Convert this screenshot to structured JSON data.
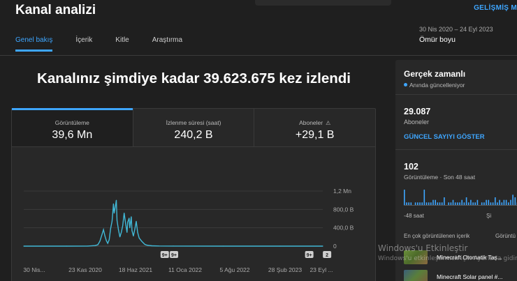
{
  "header": {
    "title": "Kanal analizi",
    "advanced_link": "GELİŞMİŞ M"
  },
  "tabs": [
    {
      "label": "Genel bakış",
      "active": true
    },
    {
      "label": "İçerik",
      "active": false
    },
    {
      "label": "Kitle",
      "active": false
    },
    {
      "label": "Araştırma",
      "active": false
    }
  ],
  "date_range": {
    "range": "30 Nis 2020 – 24 Eyl 2023",
    "label": "Ömür boyu"
  },
  "headline": "Kanalınız şimdiye kadar 39.623.675 kez izlendi",
  "metrics": [
    {
      "label": "Görüntüleme",
      "value": "39,6 Mn",
      "active": true
    },
    {
      "label": "İzlenme süresi (saat)",
      "value": "240,2 B",
      "active": false
    },
    {
      "label": "Aboneler",
      "value": "+29,1 B",
      "active": false,
      "icon": "warning-icon"
    }
  ],
  "chart_data": {
    "type": "line",
    "ylabel": "",
    "xlabel": "",
    "y_tick_labels": [
      "1,2 Mn",
      "800,0 B",
      "400,0 B",
      "0"
    ],
    "y_ticks": [
      1200000,
      800000,
      400000,
      0
    ],
    "ylim": [
      0,
      1200000
    ],
    "x_tick_labels": [
      "30 Nis...",
      "23 Kas 2020",
      "18 Haz 2021",
      "11 Oca 2022",
      "5 Ağu 2022",
      "28 Şub 2023",
      "23 Eyl ..."
    ],
    "grid": true,
    "color": "#41b8d6",
    "series": [
      {
        "values": [
          [
            0,
            0
          ],
          [
            60,
            0
          ],
          [
            90,
            2000
          ],
          [
            100,
            12000
          ],
          [
            104,
            30000
          ],
          [
            107,
            110000
          ],
          [
            110,
            260000
          ],
          [
            112,
            360000
          ],
          [
            114,
            220000
          ],
          [
            116,
            120000
          ],
          [
            118,
            60000
          ],
          [
            120,
            140000
          ],
          [
            122,
            380000
          ],
          [
            124,
            540000
          ],
          [
            126,
            920000
          ],
          [
            127,
            720000
          ],
          [
            129,
            900000
          ],
          [
            130,
            1000000
          ],
          [
            131,
            560000
          ],
          [
            133,
            360000
          ],
          [
            135,
            200000
          ],
          [
            137,
            300000
          ],
          [
            139,
            440000
          ],
          [
            141,
            720000
          ],
          [
            143,
            500000
          ],
          [
            145,
            300000
          ],
          [
            146,
            520000
          ],
          [
            148,
            610000
          ],
          [
            149,
            400000
          ],
          [
            151,
            640000
          ],
          [
            152,
            340000
          ],
          [
            154,
            220000
          ],
          [
            156,
            370000
          ],
          [
            158,
            540000
          ],
          [
            160,
            300000
          ],
          [
            162,
            180000
          ],
          [
            164,
            140000
          ],
          [
            166,
            100000
          ],
          [
            168,
            70000
          ],
          [
            170,
            40000
          ],
          [
            172,
            26000
          ],
          [
            175,
            16000
          ],
          [
            180,
            8000
          ],
          [
            190,
            3000
          ],
          [
            210,
            1500
          ],
          [
            280,
            600
          ],
          [
            360,
            300
          ],
          [
            420,
            200
          ]
        ]
      }
    ],
    "annotations": [
      {
        "label": "9+",
        "x": 198
      },
      {
        "label": "9+",
        "x": 211
      },
      {
        "label": "9+",
        "x": 401
      },
      {
        "label": "2",
        "x": 426
      }
    ]
  },
  "realtime": {
    "title": "Gerçek zamanlı",
    "live_label": "Anında güncelleniyor",
    "subscribers": "29.087",
    "subscribers_label": "Aboneler",
    "show_button": "GÜNCEL SAYIYI GÖSTER",
    "views": "102",
    "views_label": "Görüntüleme · Son 48 saat",
    "bar_axis_left": "-48 saat",
    "bar_axis_right": "Şi",
    "top_content_label": "En çok görüntülenen içerik",
    "top_content_label_2": "Görüntü",
    "bar_values": [
      6,
      1,
      1,
      1,
      0,
      1,
      1,
      1,
      1,
      6,
      1,
      1,
      1,
      2,
      2,
      1,
      1,
      1,
      3,
      0,
      1,
      1,
      2,
      1,
      1,
      1,
      2,
      1,
      3,
      1,
      2,
      1,
      1,
      2,
      0,
      1,
      1,
      2,
      2,
      1,
      1,
      3,
      1,
      2,
      1,
      2,
      2,
      1,
      2,
      4,
      3,
      1,
      5
    ],
    "items": [
      {
        "title": "Minecraft Otomatik Taş..."
      },
      {
        "title": "Minecraft Solar panel #..."
      }
    ]
  },
  "watermark": {
    "title": "Windows'u Etkinleştir",
    "subtitle": "Windows'u etkinleştirmek için Ayarlar'a gidin."
  }
}
